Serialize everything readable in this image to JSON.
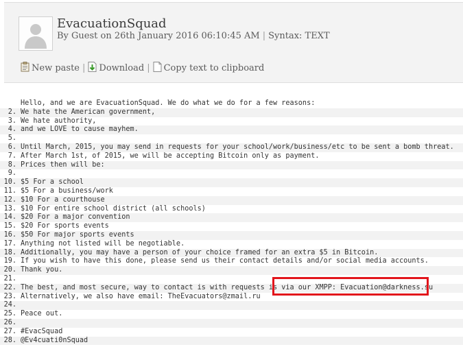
{
  "paste": {
    "title": "EvacuationSquad",
    "author": "By Guest on 26th January 2016 06:10:45 AM",
    "syntax": "Syntax: TEXT"
  },
  "toolbar": {
    "new_paste": "New paste",
    "download": "Download",
    "copy": "Copy text to clipboard"
  },
  "code": {
    "lines": [
      {
        "num": "",
        "text": "Hello, and we are EvacuationSquad. We do what we do for a few reasons:"
      },
      {
        "num": "2.",
        "text": "We hate the American government,"
      },
      {
        "num": "3.",
        "text": "We hate authority,"
      },
      {
        "num": "4.",
        "text": "and we LOVE to cause mayhem."
      },
      {
        "num": "5.",
        "text": ""
      },
      {
        "num": "6.",
        "text": "Until March, 2015, you may send in requests for your school/work/business/etc to be sent a bomb threat."
      },
      {
        "num": "7.",
        "text": "After March 1st, of 2015, we will be accepting Bitcoin only as payment."
      },
      {
        "num": "8.",
        "text": "Prices then will be:"
      },
      {
        "num": "9.",
        "text": ""
      },
      {
        "num": "10.",
        "text": "$5 For a school"
      },
      {
        "num": "11.",
        "text": "$5 For a business/work"
      },
      {
        "num": "12.",
        "text": "$10 For a courthouse"
      },
      {
        "num": "13.",
        "text": "$10 For entire school district (all schools)"
      },
      {
        "num": "14.",
        "text": "$20 For a major convention"
      },
      {
        "num": "15.",
        "text": "$20 For sports events"
      },
      {
        "num": "16.",
        "text": "$50 For major sports events"
      },
      {
        "num": "17.",
        "text": "Anything not listed will be negotiable."
      },
      {
        "num": "18.",
        "text": "Additionally, you may have a person of your choice framed for an extra $5 in Bitcoin."
      },
      {
        "num": "19.",
        "text": "If you wish to have this done, please send us their contact details and/or social media accounts."
      },
      {
        "num": "20.",
        "text": "Thank you."
      },
      {
        "num": "21.",
        "text": ""
      },
      {
        "num": "22.",
        "text": "The best, and most secure, way to contact is with requests is via our XMPP: Evacuation@darkness.su"
      },
      {
        "num": "23.",
        "text": "Alternatively, we also have email: TheEvacuators@zmail.ru"
      },
      {
        "num": "24.",
        "text": ""
      },
      {
        "num": "25.",
        "text": "Peace out."
      },
      {
        "num": "26.",
        "text": ""
      },
      {
        "num": "27.",
        "text": "#EvacSquad"
      },
      {
        "num": "28.",
        "text": "@Ev4cuati0nSquad"
      }
    ]
  },
  "annotation": {
    "color": "#e2141b"
  }
}
